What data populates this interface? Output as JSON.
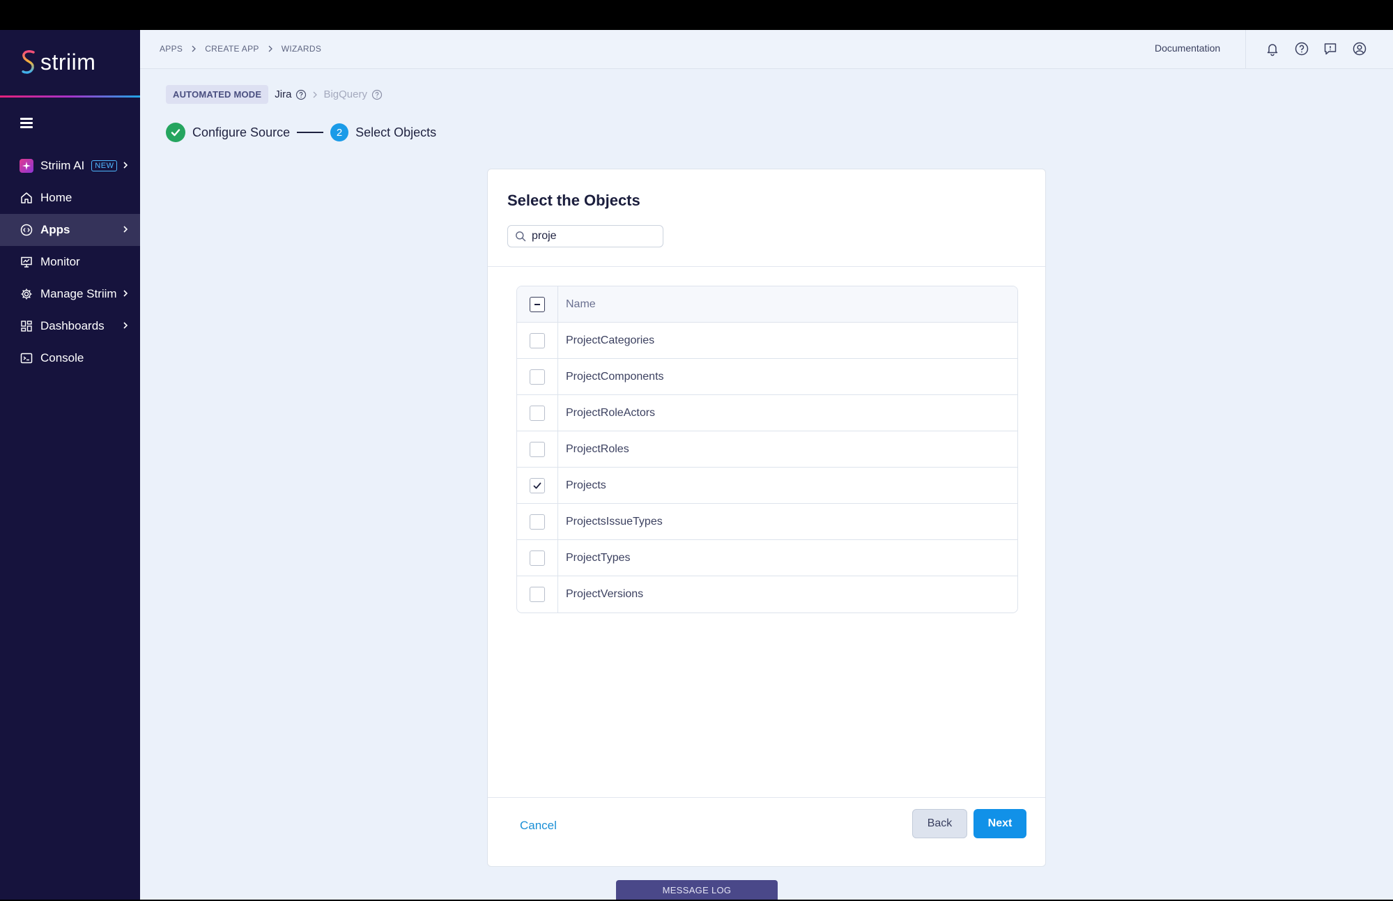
{
  "app": {
    "logo_text": "striim"
  },
  "sidebar": {
    "items": [
      {
        "label": "Striim AI",
        "badge": "NEW",
        "icon": "sparkle-icon",
        "has_chevron": true
      },
      {
        "label": "Home",
        "icon": "home-icon",
        "has_chevron": false
      },
      {
        "label": "Apps",
        "icon": "apps-icon",
        "has_chevron": true,
        "active": true
      },
      {
        "label": "Monitor",
        "icon": "monitor-icon",
        "has_chevron": false
      },
      {
        "label": "Manage Striim",
        "icon": "gear-icon",
        "has_chevron": true
      },
      {
        "label": "Dashboards",
        "icon": "dashboard-icon",
        "has_chevron": true
      },
      {
        "label": "Console",
        "icon": "terminal-icon",
        "has_chevron": false
      }
    ]
  },
  "header": {
    "breadcrumb": [
      "APPS",
      "CREATE APP",
      "WIZARDS"
    ],
    "documentation": "Documentation",
    "icons": [
      "bell-icon",
      "help-icon",
      "feedback-icon",
      "user-icon"
    ]
  },
  "wizard": {
    "mode": "AUTOMATED MODE",
    "source": "Jira",
    "target": "BigQuery",
    "steps": [
      {
        "label": "Configure Source",
        "state": "done"
      },
      {
        "label": "Select Objects",
        "number": "2",
        "state": "current"
      }
    ]
  },
  "card": {
    "title": "Select the Objects",
    "search_value": "proje",
    "column_header": "Name",
    "rows": [
      {
        "name": "ProjectCategories",
        "checked": false
      },
      {
        "name": "ProjectComponents",
        "checked": false
      },
      {
        "name": "ProjectRoleActors",
        "checked": false
      },
      {
        "name": "ProjectRoles",
        "checked": false
      },
      {
        "name": "Projects",
        "checked": true
      },
      {
        "name": "ProjectsIssueTypes",
        "checked": false
      },
      {
        "name": "ProjectTypes",
        "checked": false
      },
      {
        "name": "ProjectVersions",
        "checked": false
      }
    ],
    "cancel": "Cancel",
    "back": "Back",
    "next": "Next"
  },
  "footer": {
    "message_log": "MESSAGE LOG"
  },
  "colors": {
    "sidebar": "#16133d",
    "accent": "#1191e8",
    "success": "#25a55f"
  }
}
